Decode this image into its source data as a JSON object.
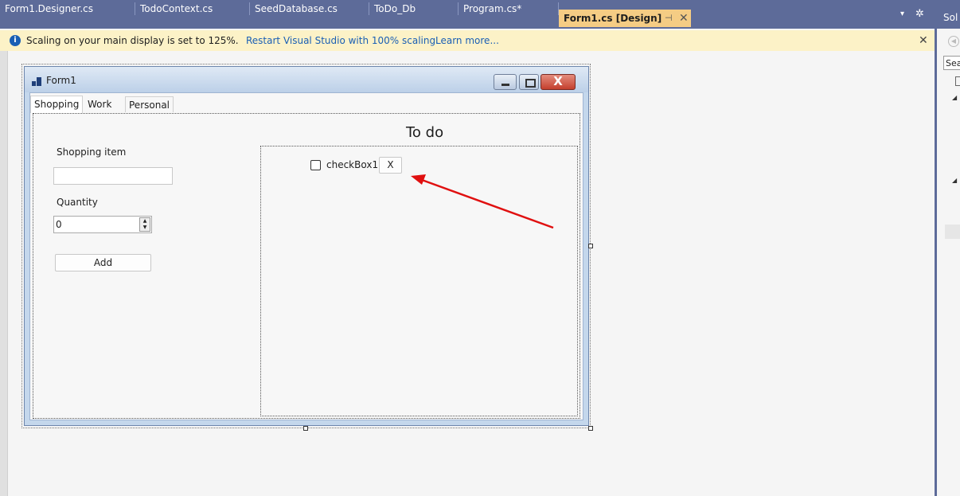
{
  "tabs": [
    {
      "label": "Form1.Designer.cs"
    },
    {
      "label": "TodoContext.cs"
    },
    {
      "label": "SeedDatabase.cs"
    },
    {
      "label": "ToDo_Db"
    },
    {
      "label": "Program.cs*"
    },
    {
      "label": "Form1.cs [Design]",
      "active": true
    }
  ],
  "tab_controls": {
    "pin": "⊣",
    "close": "✕",
    "overflow": "▾",
    "settings": "✲"
  },
  "infobar": {
    "message": "Scaling on your main display is set to 125%.",
    "restart_link": "Restart Visual Studio with 100% scaling.",
    "learn_link": "Learn more...",
    "close": "✕",
    "icon": "i"
  },
  "solution_explorer": {
    "title": "Sol",
    "search_placeholder": "Sea"
  },
  "form": {
    "title": "Form1",
    "tabs": [
      "Shopping",
      "Work",
      "Personal"
    ],
    "shopping_label": "Shopping item",
    "shopping_value": "",
    "quantity_label": "Quantity",
    "quantity_value": "0",
    "add_button": "Add",
    "todo_label": "To do",
    "checkbox_label": "checkBox1",
    "x_button": "X",
    "close_glyph": "X"
  },
  "colors": {
    "tab_strip": "#5d6b99",
    "active_tab": "#f5cc84",
    "infobar": "#fcf2c7",
    "annotation_arrow": "#e01010"
  }
}
